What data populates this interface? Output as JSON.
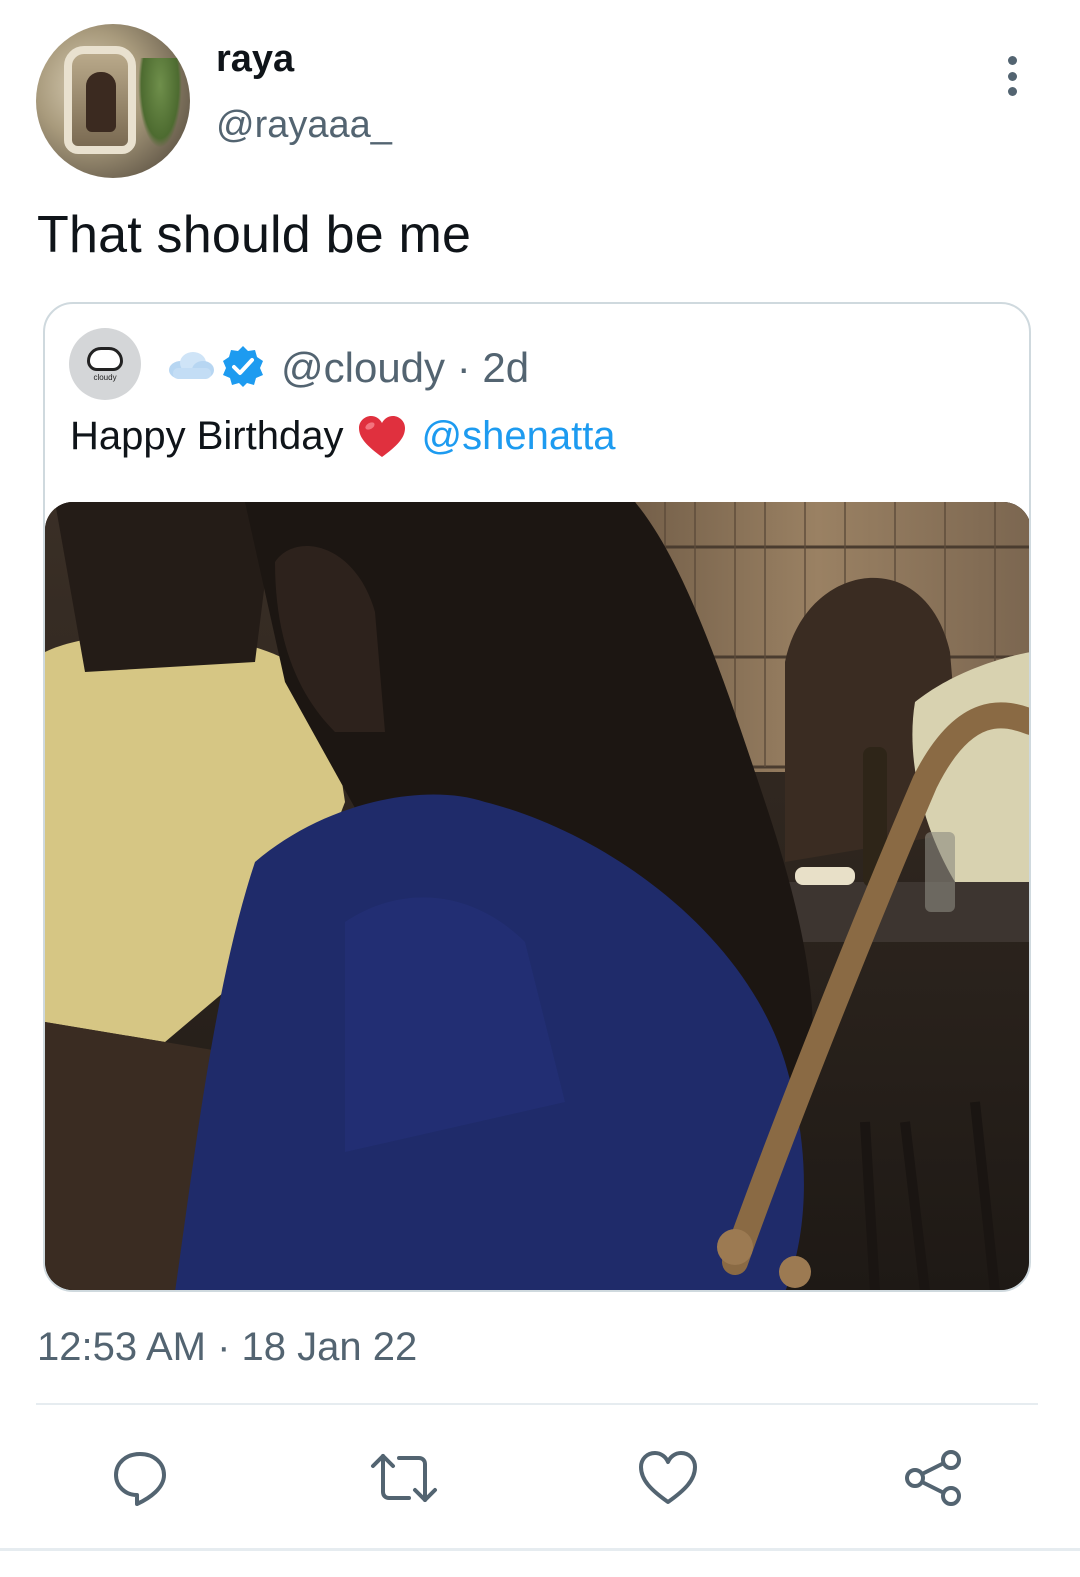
{
  "tweet": {
    "author": {
      "display_name": "raya",
      "handle": "@rayaaa_"
    },
    "text": "That should be me",
    "timestamp": "12:53 AM · 18 Jan 22"
  },
  "quoted_tweet": {
    "avatar_label": "cloudy",
    "handle_and_time": "@cloudy · 2d",
    "text": "Happy Birthday",
    "mention": "@shenatta",
    "name_emoji": "cloud-emoji",
    "text_emoji": "red-heart-emoji",
    "verified": true
  },
  "actions": [
    {
      "name": "reply",
      "icon": "reply-icon"
    },
    {
      "name": "retweet",
      "icon": "retweet-icon"
    },
    {
      "name": "like",
      "icon": "heart-icon"
    },
    {
      "name": "share",
      "icon": "share-icon"
    }
  ],
  "colors": {
    "text_primary": "#0f1419",
    "text_secondary": "#536471",
    "link": "#1d9bf0",
    "verified": "#1d9bf0",
    "border": "#cfd9de"
  }
}
